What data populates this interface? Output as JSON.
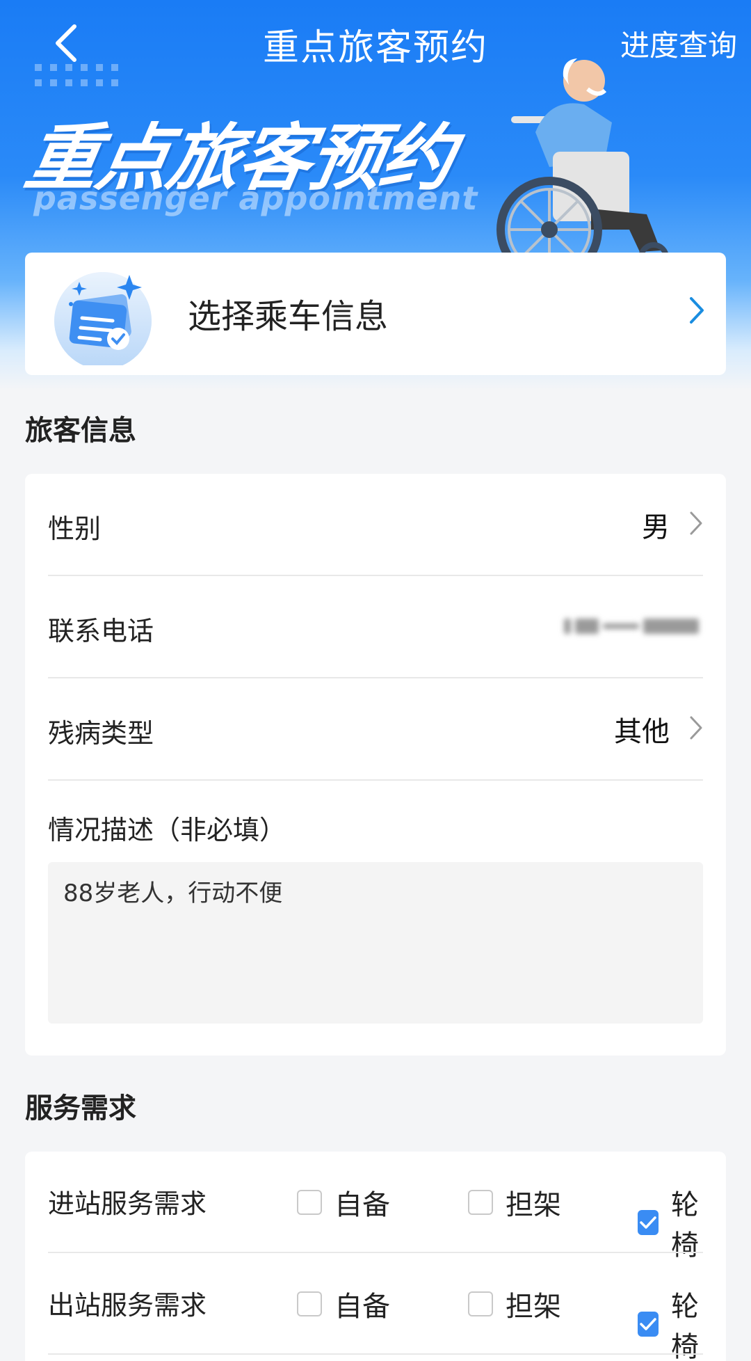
{
  "nav": {
    "title": "重点旅客预约",
    "progress_link": "进度查询"
  },
  "hero": {
    "title_cn": "重点旅客预约",
    "title_en": "passenger appointment"
  },
  "ride_card": {
    "label": "选择乘车信息"
  },
  "passenger_section": {
    "title": "旅客信息",
    "gender": {
      "label": "性别",
      "value": "男"
    },
    "phone": {
      "label": "联系电话"
    },
    "disability": {
      "label": "残病类型",
      "value": "其他"
    },
    "description": {
      "label": "情况描述（非必填）",
      "value": "88岁老人，行动不便"
    }
  },
  "service_section": {
    "title": "服务需求",
    "rows": [
      {
        "label": "进站服务需求",
        "options": [
          {
            "label": "自备",
            "checked": false
          },
          {
            "label": "担架",
            "checked": false
          },
          {
            "label": "轮椅",
            "checked": true
          }
        ]
      },
      {
        "label": "出站服务需求",
        "options": [
          {
            "label": "自备",
            "checked": false
          },
          {
            "label": "担架",
            "checked": false
          },
          {
            "label": "轮椅",
            "checked": true
          }
        ]
      }
    ]
  },
  "colors": {
    "primary_blue": "#1a7cf5",
    "checkbox_blue": "#3a8cf3",
    "chevron_blue": "#1a8de0"
  }
}
